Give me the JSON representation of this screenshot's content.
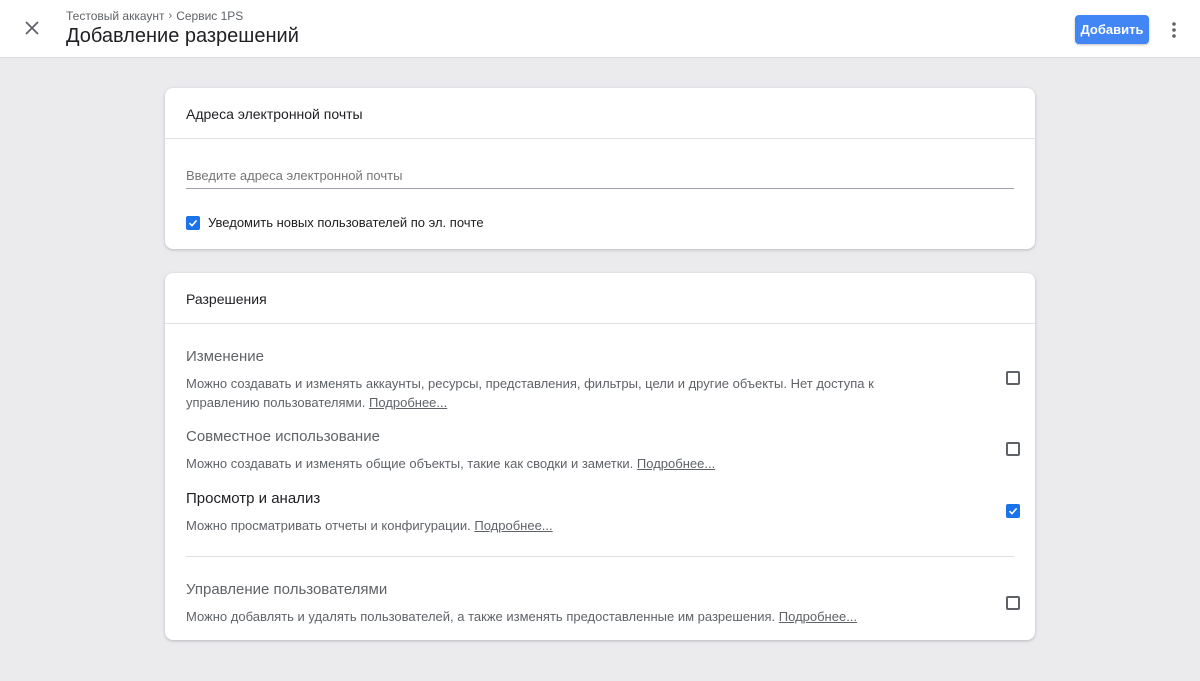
{
  "header": {
    "breadcrumb": [
      "Тестовый аккаунт",
      "Сервис 1PS"
    ],
    "breadcrumb_separator": "›",
    "title": "Добавление разрешений",
    "add_label": "Добавить",
    "accent_color": "#4285f4"
  },
  "email_card": {
    "title": "Адреса электронной почты",
    "input_value": "",
    "input_placeholder": "Введите адреса электронной почты",
    "notify_label": "Уведомить новых пользователей по эл. почте",
    "notify_checked": true
  },
  "permissions_card": {
    "title": "Разрешения",
    "items": [
      {
        "title": "Изменение",
        "description": "Можно создавать и изменять аккаунты, ресурсы, представления, фильтры, цели и другие объекты. Нет доступа к управлению пользователями.",
        "link": "Подробнее...",
        "checked": false
      },
      {
        "title": "Совместное использование",
        "description": "Можно создавать и изменять общие объекты, такие как сводки и заметки.",
        "link": "Подробнее...",
        "checked": false
      },
      {
        "title": "Просмотр и анализ",
        "description": "Можно просматривать отчеты и конфигурации.",
        "link": "Подробнее...",
        "checked": true
      },
      {
        "title": "Управление пользователями",
        "description": "Можно добавлять и удалять пользователей, а также изменять предоставленные им разрешения.",
        "link": "Подробнее...",
        "checked": false
      }
    ]
  },
  "icons": {
    "close": "close-icon",
    "more": "more-vert-icon",
    "check": "check-icon"
  }
}
